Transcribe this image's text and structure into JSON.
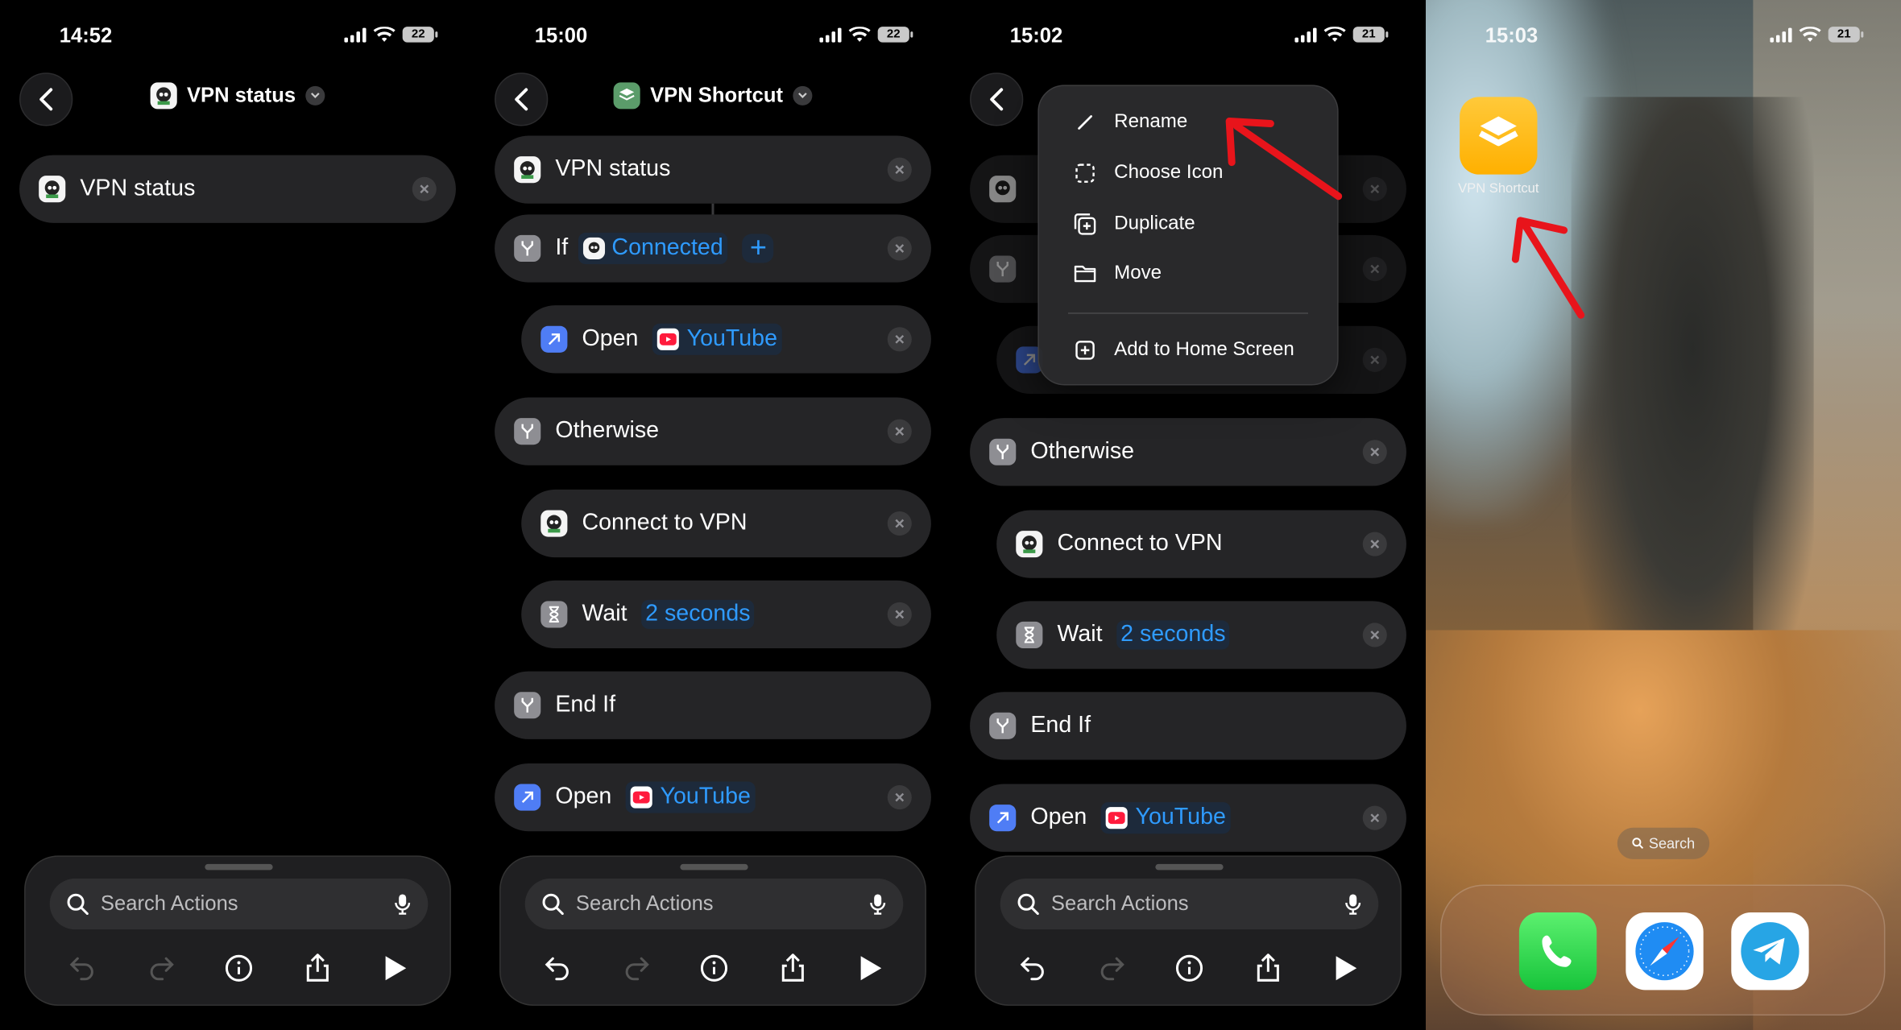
{
  "screens": [
    {
      "time": "14:52",
      "battery": "22",
      "title": "VPN status",
      "actions": [
        "VPN status"
      ],
      "search_placeholder": "Search Actions"
    },
    {
      "time": "15:00",
      "battery": "22",
      "title": "VPN Shortcut",
      "actions": {
        "vpn_status": "VPN status",
        "if": "If",
        "if_value": "Connected",
        "open1": "Open",
        "open1_app": "YouTube",
        "otherwise": "Otherwise",
        "connect": "Connect to VPN",
        "wait": "Wait",
        "wait_value": "2 seconds",
        "endif": "End If",
        "open2": "Open",
        "open2_app": "YouTube"
      },
      "search_placeholder": "Search Actions"
    },
    {
      "time": "15:02",
      "battery": "21",
      "menu": {
        "rename": "Rename",
        "choose_icon": "Choose Icon",
        "duplicate": "Duplicate",
        "move": "Move",
        "add_home": "Add to Home Screen"
      },
      "actions": {
        "otherwise": "Otherwise",
        "connect": "Connect to VPN",
        "wait": "Wait",
        "wait_value": "2 seconds",
        "endif": "End If",
        "open": "Open",
        "open_app": "YouTube"
      },
      "search_placeholder": "Search Actions"
    },
    {
      "time": "15:03",
      "battery": "21",
      "shortcut_label": "VPN Shortcut",
      "search_pill": "Search",
      "dock": [
        "phone-app",
        "safari-app",
        "telegram-app"
      ]
    }
  ],
  "colors": {
    "token_blue": "#2f9bff",
    "shortcut_yellow": "#ffc93a",
    "arrow_red": "#e8141b"
  }
}
